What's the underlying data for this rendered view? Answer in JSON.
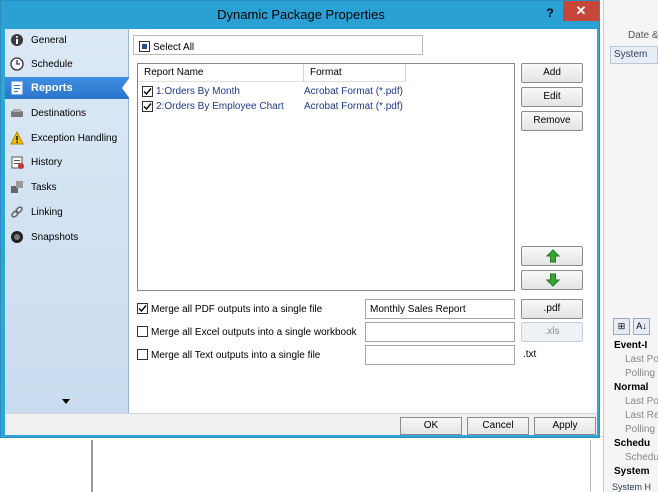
{
  "window": {
    "title": "Dynamic Package Properties",
    "help": "?",
    "close": "✕"
  },
  "background": {
    "date_label": "Date &",
    "system_tab": "System",
    "grid_toolbar": [
      "⊞",
      "A↓"
    ],
    "properties": [
      {
        "text": "Event-I",
        "category": true
      },
      {
        "text": "Last Poli",
        "category": false
      },
      {
        "text": "Polling I",
        "category": false
      },
      {
        "text": "Normal",
        "category": true
      },
      {
        "text": "Last Pol",
        "category": false
      },
      {
        "text": "Last Res",
        "category": false
      },
      {
        "text": "Polling I",
        "category": false
      },
      {
        "text": "Schedu",
        "category": true
      },
      {
        "text": "Schedul",
        "category": false
      },
      {
        "text": "System",
        "category": true
      }
    ],
    "bottom_tab": "System  H"
  },
  "nav": {
    "items": [
      {
        "label": "General",
        "icon": "info-icon"
      },
      {
        "label": "Schedule",
        "icon": "clock-icon"
      },
      {
        "label": "Reports",
        "icon": "reports-icon",
        "active": true
      },
      {
        "label": "Destinations",
        "icon": "destinations-icon"
      },
      {
        "label": "Exception Handling",
        "icon": "warning-icon"
      },
      {
        "label": "History",
        "icon": "history-icon"
      },
      {
        "label": "Tasks",
        "icon": "tasks-icon"
      },
      {
        "label": "Linking",
        "icon": "link-icon"
      },
      {
        "label": "Snapshots",
        "icon": "camera-icon"
      }
    ]
  },
  "reports": {
    "select_all_label": "Select All",
    "columns": [
      "Report Name",
      "Format"
    ],
    "rows": [
      {
        "name": "1:Orders By Month",
        "format": "Acrobat Format (*.pdf)",
        "checked": true
      },
      {
        "name": "2:Orders By Employee Chart",
        "format": "Acrobat Format (*.pdf)",
        "checked": true
      }
    ],
    "buttons": {
      "add": "Add",
      "edit": "Edit",
      "remove": "Remove"
    }
  },
  "merge": {
    "pdf": {
      "label": "Merge all PDF outputs into a single file",
      "checked": true,
      "value": "Monthly Sales Report",
      "ext": ".pdf"
    },
    "excel": {
      "label": "Merge all Excel outputs into a single workbook",
      "checked": false,
      "value": "",
      "ext": ".xls"
    },
    "text": {
      "label": "Merge all Text outputs into a single file",
      "checked": false,
      "value": "",
      "ext": ".txt"
    }
  },
  "footer": {
    "ok": "OK",
    "cancel": "Cancel",
    "apply": "Apply"
  },
  "colors": {
    "titlebar": "#2aa0d4",
    "nav_active": "#2a75cc",
    "close": "#c7463a",
    "link_text": "#1e3a8a",
    "arrow_green": "#3aa635"
  }
}
